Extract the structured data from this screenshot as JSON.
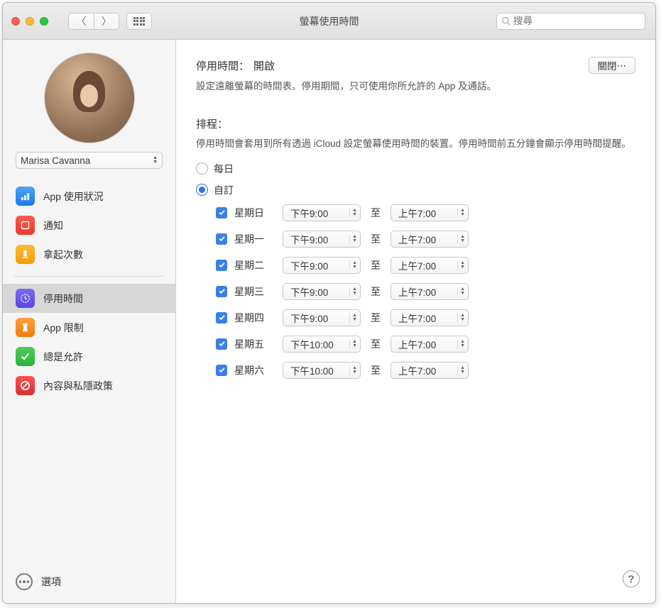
{
  "window": {
    "title": "螢幕使用時間"
  },
  "search": {
    "placeholder": "搜尋"
  },
  "user": {
    "name": "Marisa Cavanna"
  },
  "sidebar": {
    "items": [
      {
        "label": "App 使用狀況"
      },
      {
        "label": "通知"
      },
      {
        "label": "拿起次數"
      },
      {
        "label": "停用時間"
      },
      {
        "label": "App 限制"
      },
      {
        "label": "總是允許"
      },
      {
        "label": "內容與私隱政策"
      }
    ],
    "options_label": "選項"
  },
  "main": {
    "status_label": "停用時間：",
    "status_value": "開啟",
    "turn_off_button": "關閉⋯",
    "status_desc": "設定遠離螢幕的時間表。停用期間，只可使用你所允許的 App 及通話。",
    "schedule_title": "排程：",
    "schedule_desc": "停用時間會套用到所有透過 iCloud 設定螢幕使用時間的裝置。停用時間前五分鐘會顯示停用時間提醒。",
    "radio_daily": "每日",
    "radio_custom": "自訂",
    "to_label": "至",
    "days": [
      {
        "name": "星期日",
        "checked": true,
        "from": "下午9:00",
        "to": "上午7:00"
      },
      {
        "name": "星期一",
        "checked": true,
        "from": "下午9:00",
        "to": "上午7:00"
      },
      {
        "name": "星期二",
        "checked": true,
        "from": "下午9:00",
        "to": "上午7:00"
      },
      {
        "name": "星期三",
        "checked": true,
        "from": "下午9:00",
        "to": "上午7:00"
      },
      {
        "name": "星期四",
        "checked": true,
        "from": "下午9:00",
        "to": "上午7:00"
      },
      {
        "name": "星期五",
        "checked": true,
        "from": "下午10:00",
        "to": "上午7:00"
      },
      {
        "name": "星期六",
        "checked": true,
        "from": "下午10:00",
        "to": "上午7:00"
      }
    ]
  }
}
